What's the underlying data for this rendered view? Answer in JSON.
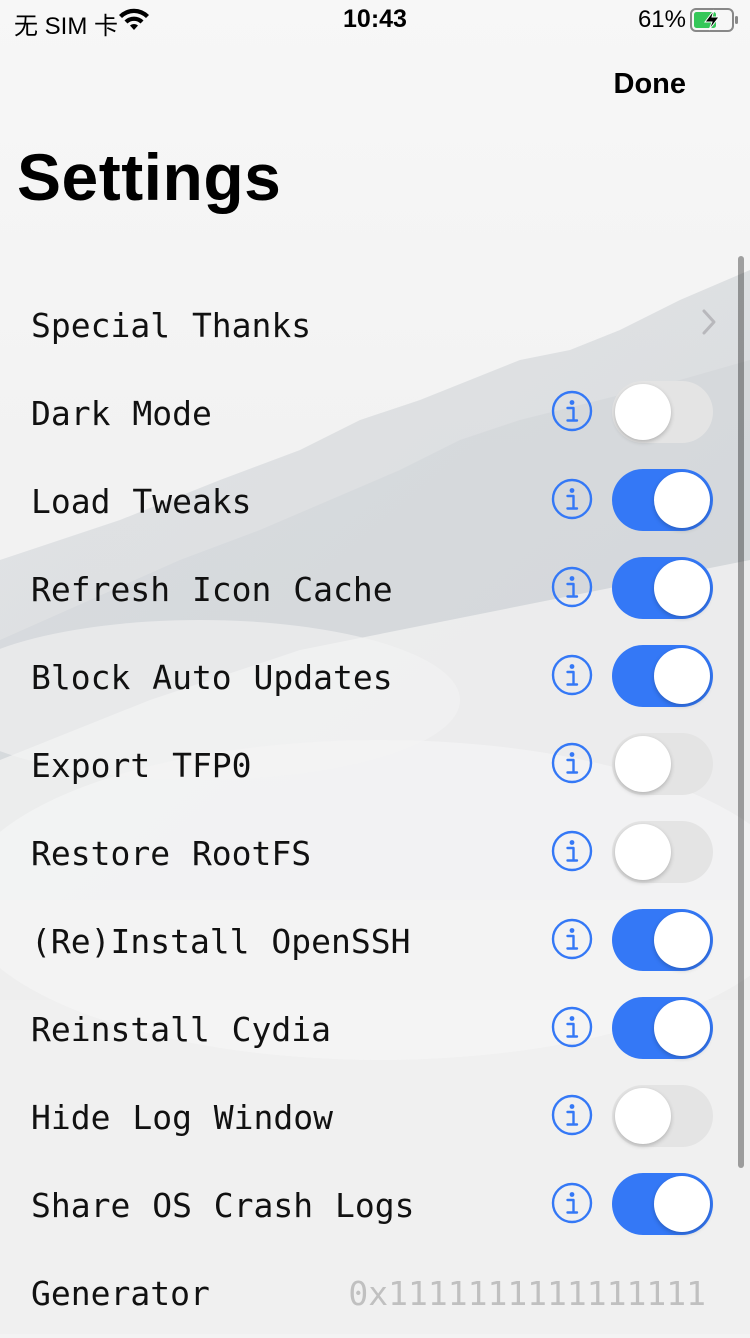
{
  "status_bar": {
    "carrier": "无 SIM 卡",
    "time": "10:43",
    "battery_percent": "61%",
    "battery_level": 0.61,
    "icons": [
      "wifi-icon",
      "battery-charging-icon"
    ]
  },
  "nav": {
    "done_label": "Done"
  },
  "title": "Settings",
  "colors": {
    "accent": "#3478f6",
    "toggle_off": "#e4e4e4",
    "info_icon": "#3478f6"
  },
  "rows": [
    {
      "label": "Special Thanks",
      "type": "link",
      "icon": "chevron-right-icon"
    },
    {
      "label": "Dark Mode",
      "type": "toggle",
      "on": false,
      "icon": "info-icon"
    },
    {
      "label": "Load Tweaks",
      "type": "toggle",
      "on": true,
      "icon": "info-icon"
    },
    {
      "label": "Refresh Icon Cache",
      "type": "toggle",
      "on": true,
      "icon": "info-icon"
    },
    {
      "label": "Block Auto Updates",
      "type": "toggle",
      "on": true,
      "icon": "info-icon"
    },
    {
      "label": "Export TFP0",
      "type": "toggle",
      "on": false,
      "icon": "info-icon"
    },
    {
      "label": "Restore RootFS",
      "type": "toggle",
      "on": false,
      "icon": "info-icon"
    },
    {
      "label": "(Re)Install OpenSSH",
      "type": "toggle",
      "on": true,
      "icon": "info-icon"
    },
    {
      "label": "Reinstall Cydia",
      "type": "toggle",
      "on": true,
      "icon": "info-icon"
    },
    {
      "label": "Hide Log Window",
      "type": "toggle",
      "on": false,
      "icon": "info-icon"
    },
    {
      "label": "Share OS Crash Logs",
      "type": "toggle",
      "on": true,
      "icon": "info-icon"
    },
    {
      "label": "Generator",
      "type": "value",
      "value": "0x1111111111111111"
    }
  ]
}
